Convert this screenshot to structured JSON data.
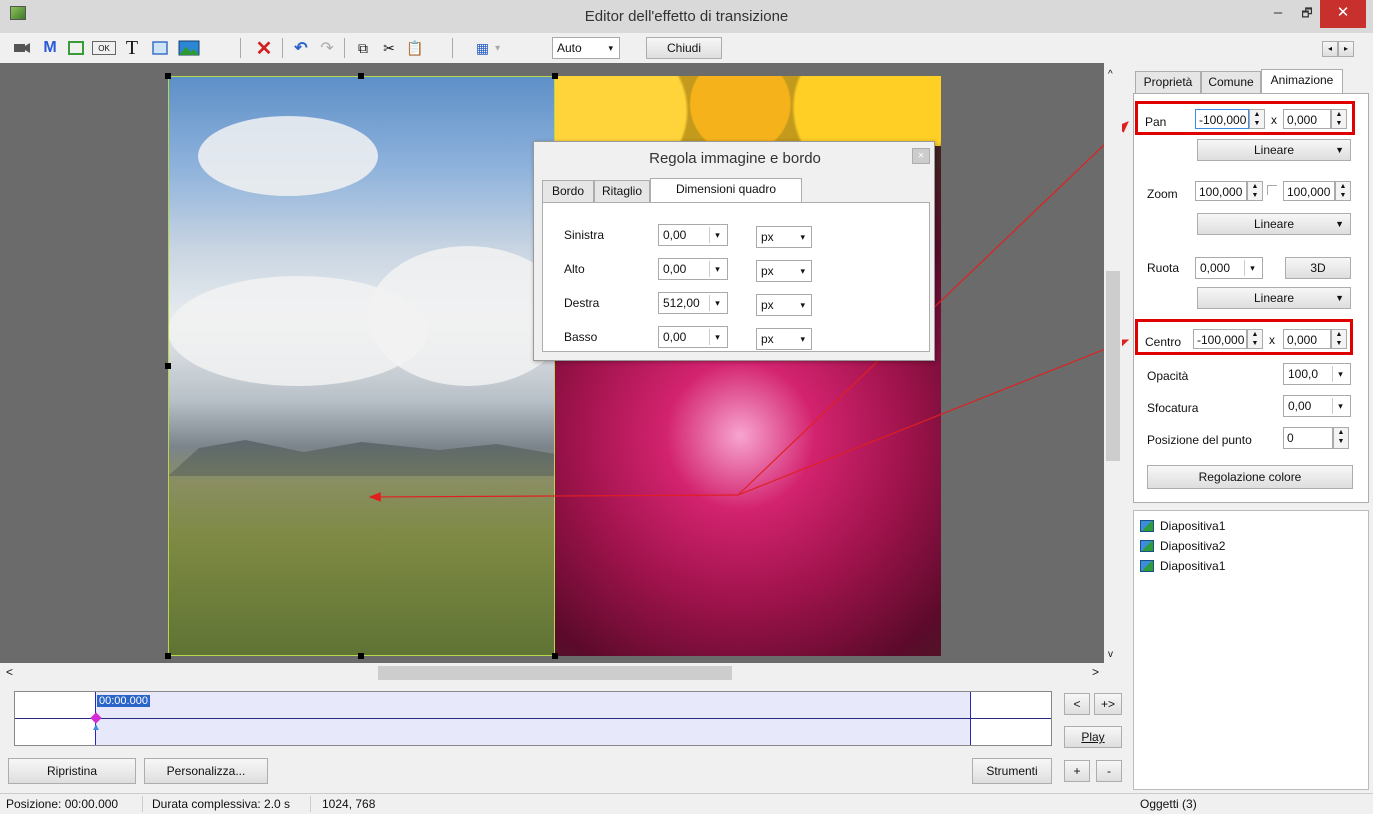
{
  "window": {
    "title": "Editor dell'effetto di transizione",
    "minimize": "–",
    "restore": "🗗",
    "close": "✕"
  },
  "toolbar": {
    "icons": [
      "camera-icon",
      "M",
      "rect-icon",
      "button-icon",
      "T",
      "frame-icon",
      "image-icon",
      "delete-icon",
      "undo-icon",
      "redo-icon",
      "copy-icon",
      "cut-icon",
      "paste-icon",
      "grid-icon"
    ],
    "m_label": "M",
    "t_label": "T",
    "ok_label": "OK",
    "zoom_value": "Auto",
    "close_label": "Chiudi"
  },
  "dialog": {
    "title": "Regola immagine e bordo",
    "tabs": [
      "Bordo",
      "Ritaglio",
      "Dimensioni quadro"
    ],
    "active_tab": "Dimensioni quadro",
    "rows": [
      {
        "label": "Sinistra",
        "value": "0,00",
        "unit": "px"
      },
      {
        "label": "Alto",
        "value": "0,00",
        "unit": "px"
      },
      {
        "label": "Destra",
        "value": "512,00",
        "unit": "px"
      },
      {
        "label": "Basso",
        "value": "0,00",
        "unit": "px"
      }
    ]
  },
  "timeline": {
    "time": "00:00.000"
  },
  "bottom": {
    "reset": "Ripristina",
    "customize": "Personalizza...",
    "tools": "Strumenti",
    "play": "Play",
    "prev": "<",
    "expand": "+>",
    "plus": "+",
    "minus": "-"
  },
  "status": {
    "position": "Posizione:  00:00.000",
    "duration": "Durata complessiva:  2.0 s",
    "resolution": "1024, 768",
    "objects": "Oggetti (3)"
  },
  "panel": {
    "tabs": [
      "Proprietà",
      "Comune",
      "Animazione"
    ],
    "active_tab": "Animazione",
    "pan_label": "Pan",
    "pan_x": "-100,000",
    "pan_y": "0,000",
    "x": "x",
    "pan_interp": "Lineare",
    "zoom_label": "Zoom",
    "zoom_x": "100,000",
    "zoom_y": "100,000",
    "zoom_interp": "Lineare",
    "rotate_label": "Ruota",
    "rotate_value": "0,000",
    "btn_3d": "3D",
    "rotate_interp": "Lineare",
    "center_label": "Centro",
    "center_x": "-100,000",
    "center_y": "0,000",
    "opacity_label": "Opacità",
    "opacity_value": "100,0",
    "blur_label": "Sfocatura",
    "blur_value": "0,00",
    "point_label": "Posizione del punto",
    "point_value": "0",
    "color_button": "Regolazione colore"
  },
  "objects": [
    "Diapositiva1",
    "Diapositiva2",
    "Diapositiva1"
  ]
}
